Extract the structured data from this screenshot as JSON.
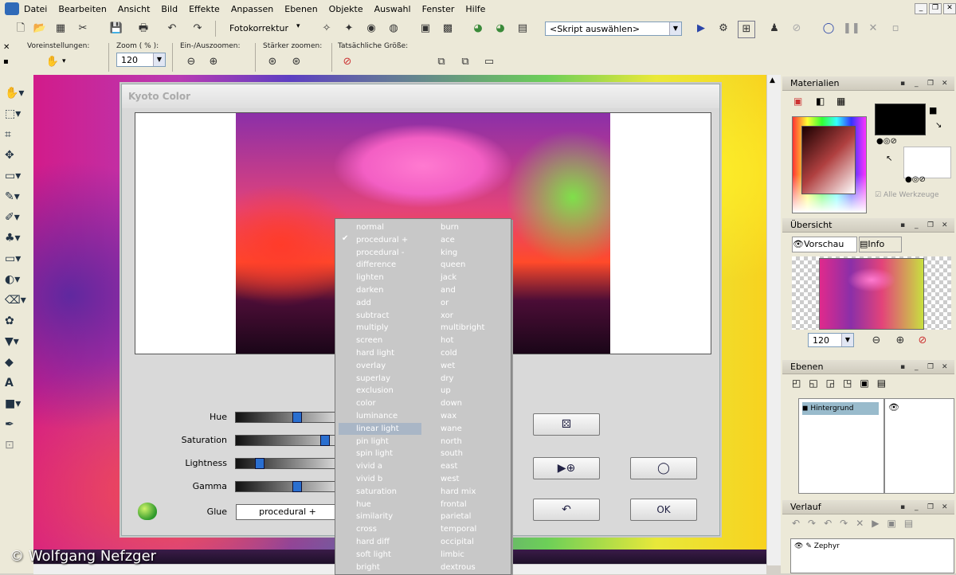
{
  "menubar": {
    "items": [
      "Datei",
      "Bearbeiten",
      "Ansicht",
      "Bild",
      "Effekte",
      "Anpassen",
      "Ebenen",
      "Objekte",
      "Auswahl",
      "Fenster",
      "Hilfe"
    ]
  },
  "toolbar1": {
    "fotokorrektur": "Fotokorrektur",
    "script_select": "<Skript auswählen>"
  },
  "toolbar2": {
    "group_presets": "Voreinstellungen:",
    "group_zoom_pct": "Zoom ( % ):",
    "group_zoom_inout": "Ein-/Auszoomen:",
    "group_zoom_stronger": "Stärker zoomen:",
    "group_actual_size": "Tatsächliche Größe:",
    "zoom_value": "120"
  },
  "dialog": {
    "title": "Kyoto Color",
    "sliders": [
      {
        "label": "Hue",
        "value": 0.6
      },
      {
        "label": "Saturation",
        "value": 0.9
      },
      {
        "label": "Lightness",
        "value": 0.2
      },
      {
        "label": "Gamma",
        "value": 0.6
      }
    ],
    "glue_label": "Glue",
    "glue_value": "procedural +",
    "ok_label": "OK"
  },
  "dropdown": {
    "col1": [
      "normal",
      "procedural +",
      "procedural -",
      "difference",
      "lighten",
      "darken",
      "add",
      "subtract",
      "multiply",
      "screen",
      "hard light",
      "overlay",
      "superlay",
      "exclusion",
      "color",
      "luminance",
      "linear light",
      "pin light",
      "spin light",
      "vivid a",
      "vivid b",
      "saturation",
      "hue",
      "similarity",
      "cross",
      "hard diff",
      "soft light",
      "bright"
    ],
    "col2": [
      "burn",
      "ace",
      "king",
      "queen",
      "jack",
      "and",
      "or",
      "xor",
      "multibright",
      "hot",
      "cold",
      "wet",
      "dry",
      "up",
      "down",
      "wax",
      "wane",
      "north",
      "south",
      "east",
      "west",
      "hard mix",
      "frontal",
      "parietal",
      "temporal",
      "occipital",
      "limbic",
      "dextrous"
    ],
    "checked_index": 1,
    "highlight_index": 16
  },
  "panels": {
    "materials": "Materialien",
    "all_tools": "Alle Werkzeuge",
    "overview": "Übersicht",
    "preview_tab": "Vorschau",
    "info_tab": "Info",
    "overview_zoom": "120",
    "layers": "Ebenen",
    "layer_name": "Hintergrund",
    "history": "Verlauf",
    "history_item": "Zephyr"
  },
  "watermark": "© Wolfgang Nefzger"
}
